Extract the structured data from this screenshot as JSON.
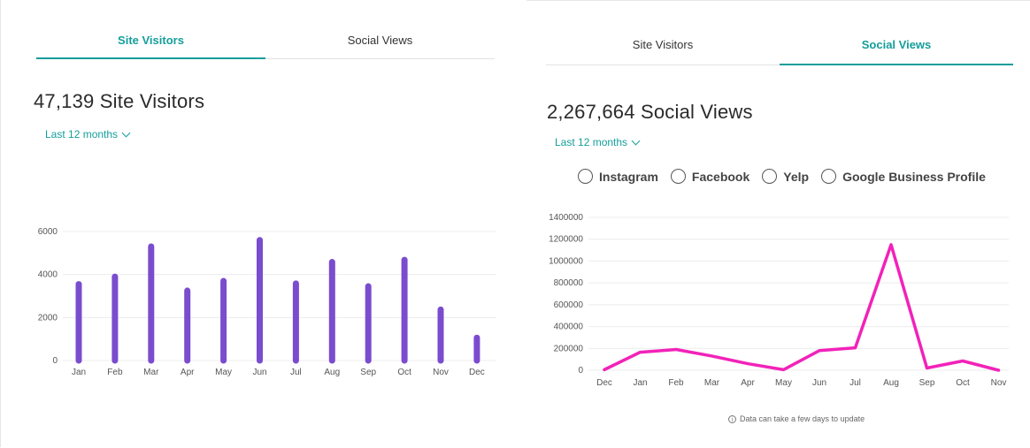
{
  "left_panel": {
    "tabs": [
      {
        "label": "Site Visitors",
        "active": true
      },
      {
        "label": "Social Views",
        "active": false
      }
    ],
    "title": "47,139 Site Visitors",
    "range_label": "Last 12 months"
  },
  "right_panel": {
    "tabs": [
      {
        "label": "Site Visitors",
        "active": false
      },
      {
        "label": "Social Views",
        "active": true
      }
    ],
    "title": "2,267,664 Social Views",
    "range_label": "Last 12 months",
    "filters": [
      "Instagram",
      "Facebook",
      "Yelp",
      "Google Business Profile"
    ],
    "note": "Data can take a few days to update"
  },
  "colors": {
    "accent": "#149e9a",
    "bar": "#7a4cce",
    "line": "#f222b9",
    "grid": "#ececec"
  },
  "icons": {
    "dropdown": "chevron-down-icon",
    "radio": "radio-unchecked-icon",
    "info": "info-icon"
  },
  "chart_data": [
    {
      "type": "bar",
      "categories": [
        "Jan",
        "Feb",
        "Mar",
        "Apr",
        "May",
        "Jun",
        "Jul",
        "Aug",
        "Sep",
        "Oct",
        "Nov",
        "Dec"
      ],
      "values": [
        3550,
        3900,
        5300,
        3250,
        3700,
        5600,
        3580,
        4580,
        3450,
        4680,
        2370,
        1060
      ],
      "yticks": [
        0,
        2000,
        4000,
        6000
      ],
      "ylim": [
        0,
        6000
      ],
      "grid": true
    },
    {
      "type": "line",
      "categories": [
        "Dec",
        "Jan",
        "Feb",
        "Mar",
        "Apr",
        "May",
        "Jun",
        "Jul",
        "Aug",
        "Sep",
        "Oct",
        "Nov"
      ],
      "values": [
        5000,
        165000,
        190000,
        130000,
        60000,
        5000,
        180000,
        205000,
        1150000,
        20000,
        85000,
        0
      ],
      "yticks": [
        0,
        200000,
        400000,
        600000,
        800000,
        1000000,
        1200000,
        1400000
      ],
      "ylim": [
        0,
        1400000
      ],
      "grid": true
    }
  ]
}
